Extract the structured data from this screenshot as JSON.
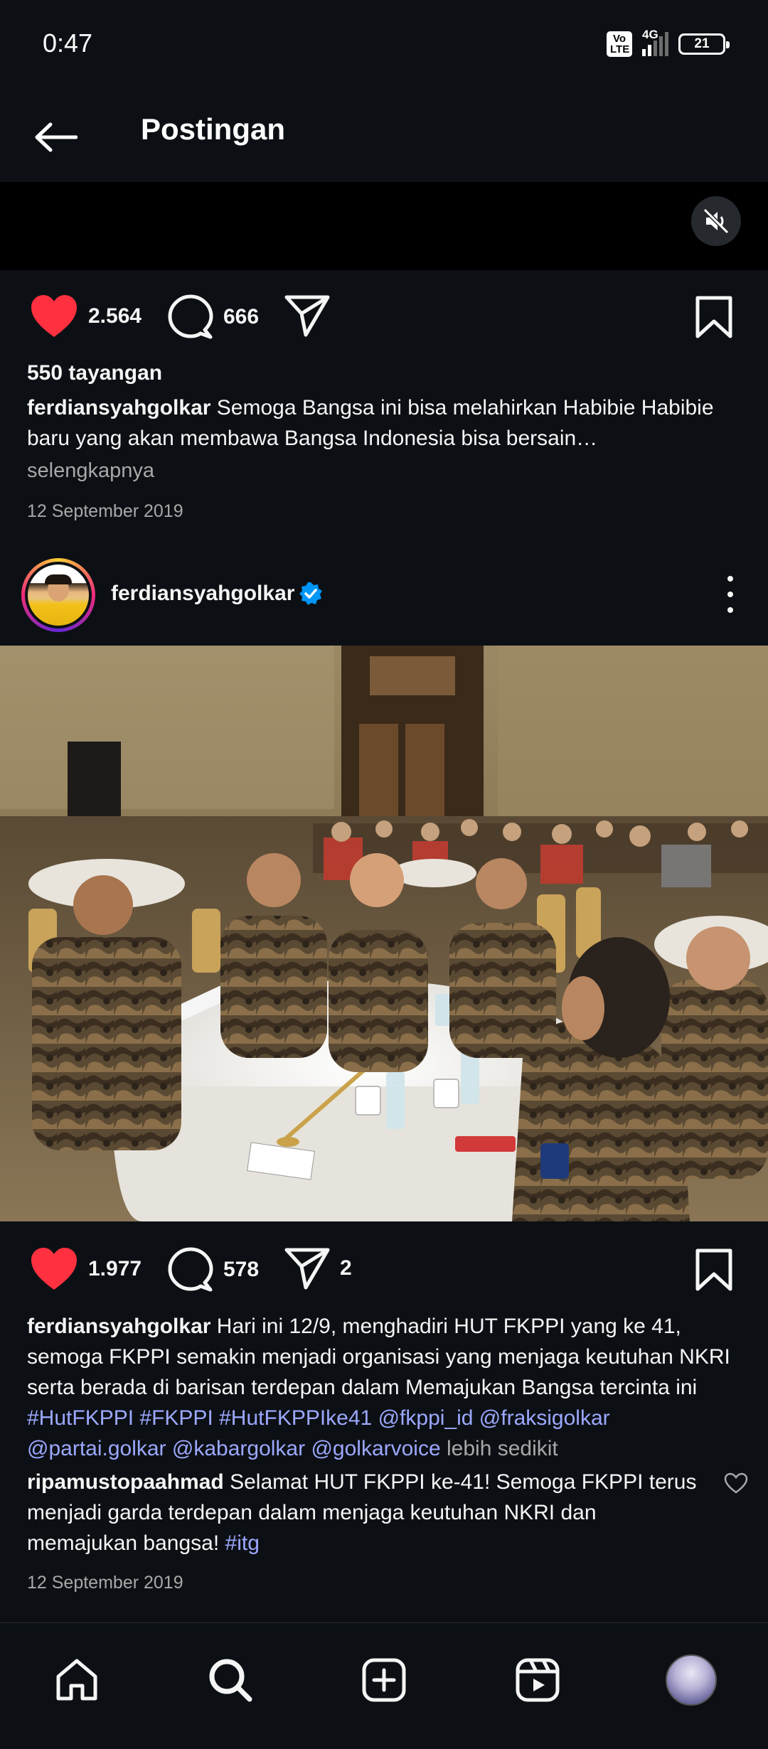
{
  "status_bar": {
    "time": "0:47",
    "volte": "Vo LTE",
    "network": "4G",
    "battery": "21"
  },
  "header": {
    "title": "Postingan"
  },
  "post1": {
    "likes": "2.564",
    "comments": "666",
    "views": "550 tayangan",
    "username": "ferdiansyahgolkar",
    "caption": "Semoga Bangsa ini bisa melahirkan Habibie Habibie baru yang akan membawa Bangsa Indonesia bisa bersain…",
    "more_label": "selengkapnya",
    "date": "12 September 2019"
  },
  "post2": {
    "username": "ferdiansyahgolkar",
    "likes": "1.977",
    "comments": "578",
    "shares": "2",
    "caption_username": "ferdiansyahgolkar",
    "caption_text": "Hari ini 12/9, menghadiri HUT FKPPI yang ke 41, semoga FKPPI semakin menjadi organisasi yang menjaga keutuhan NKRI serta berada di barisan terdepan dalam Memajukan Bangsa tercinta ini",
    "hashtags": [
      "#HutFKPPI",
      "#FKPPI",
      "#HutFKPPIke41",
      "@fkppi_id",
      "@fraksigolkar",
      "@partai.golkar",
      "@kabargolkar",
      "@golkarvoice"
    ],
    "less_label": "lebih sedikit",
    "comment": {
      "username": "ripamustopaahmad",
      "text": "Selamat HUT FKPPI ke-41! Semoga FKPPI terus menjadi garda terdepan dalam menjaga keutuhan NKRI dan memajukan bangsa!",
      "tag": "#itg"
    },
    "date": "12 September 2019"
  },
  "colors": {
    "background": "#0c1014",
    "like_red": "#ff3040",
    "link": "#9ca8ff",
    "verified_blue": "#0095f6",
    "muted_text": "#a8a8a8"
  },
  "nav": [
    "home-icon",
    "search-icon",
    "create-icon",
    "reels-icon",
    "profile-avatar"
  ]
}
